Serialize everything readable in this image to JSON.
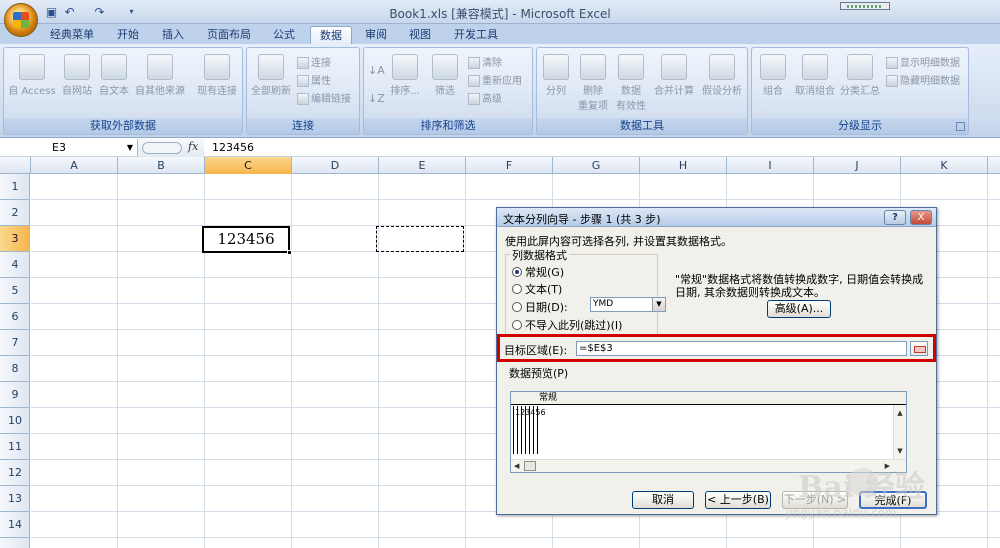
{
  "window": {
    "title": "Book1.xls  [兼容模式] - Microsoft Excel"
  },
  "tabs": [
    {
      "label": "经典菜单"
    },
    {
      "label": "开始"
    },
    {
      "label": "插入"
    },
    {
      "label": "页面布局"
    },
    {
      "label": "公式"
    },
    {
      "label": "数据"
    },
    {
      "label": "审阅"
    },
    {
      "label": "视图"
    },
    {
      "label": "开发工具"
    }
  ],
  "active_tab": "数据",
  "ribbon": {
    "groups": [
      {
        "label": "获取外部数据",
        "buttons": [
          "自 Access",
          "自网站",
          "自文本",
          "自其他来源",
          "现有连接"
        ]
      },
      {
        "label": "连接",
        "buttons": [
          "全部刷新"
        ],
        "small": [
          "连接",
          "属性",
          "编辑链接"
        ]
      },
      {
        "label": "排序和筛选",
        "buttons": [
          "排序...",
          "筛选"
        ],
        "small": [
          "清除",
          "重新应用",
          "高级"
        ]
      },
      {
        "label": "数据工具",
        "buttons": [
          "分列",
          "删除\n重复项",
          "数据\n有效性",
          "合并计算",
          "假设分析"
        ]
      },
      {
        "label": "分级显示",
        "buttons": [
          "组合",
          "取消组合",
          "分类汇总"
        ],
        "small": [
          "显示明细数据",
          "隐藏明细数据"
        ]
      }
    ]
  },
  "formula_bar": {
    "name_box": "E3",
    "fx": "fx",
    "value": "123456"
  },
  "columns": [
    "A",
    "B",
    "C",
    "D",
    "E",
    "F",
    "G",
    "H",
    "I",
    "J",
    "K"
  ],
  "rows": [
    "1",
    "2",
    "3",
    "4",
    "5",
    "6",
    "7",
    "8",
    "9",
    "10",
    "11",
    "12",
    "13",
    "14"
  ],
  "cells": {
    "C3": "123456"
  },
  "dialog": {
    "title": "文本分列向导 - 步骤 1 (共 3 步)",
    "help": "?",
    "close": "X",
    "description": "使用此屏内容可选择各列, 并设置其数据格式。",
    "format_legend": "列数据格式",
    "radios": [
      {
        "label": "常规(G)",
        "checked": true
      },
      {
        "label": "文本(T)",
        "checked": false
      },
      {
        "label": "日期(D):",
        "checked": false
      },
      {
        "label": "不导入此列(跳过)(I)",
        "checked": false
      }
    ],
    "date_format": "YMD",
    "note": "\"常规\"数据格式将数值转换成数字, 日期值会转换成日期, 其余数据则转换成文本。",
    "advanced_button": "高级(A)...",
    "destination_label": "目标区域(E):",
    "destination_value": "=$E$3",
    "preview_label": "数据预览(P)",
    "preview_header": "常规",
    "preview_value": "123456",
    "buttons": {
      "cancel": "取消",
      "back": "< 上一步(B)",
      "next": "下一步(N) >",
      "finish": "完成(F)"
    }
  },
  "watermark": {
    "text": "Bai 经验",
    "url": "jingyan.baidu.com"
  }
}
